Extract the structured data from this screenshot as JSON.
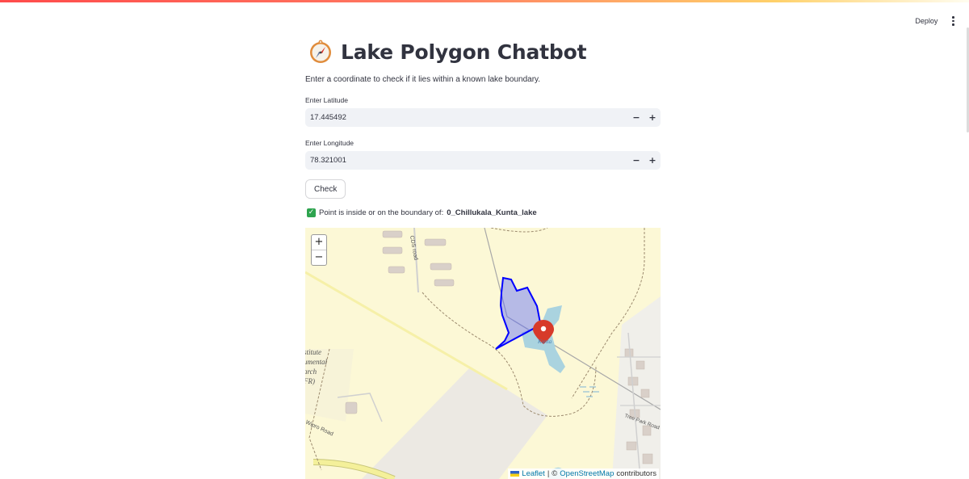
{
  "header": {
    "deploy_label": "Deploy",
    "menu_icon": "kebab-menu-icon"
  },
  "title": {
    "icon": "compass-icon",
    "text": "Lake Polygon Chatbot"
  },
  "caption": "Enter a coordinate to check if it lies within a known lake boundary.",
  "latitude": {
    "label": "Enter Latitude",
    "value": "17.445492",
    "decrement": "−",
    "increment": "+"
  },
  "longitude": {
    "label": "Enter Longitude",
    "value": "78.321001",
    "decrement": "−",
    "increment": "+"
  },
  "check_button": "Check",
  "result": {
    "icon": "check-mark-icon",
    "prefix": "Point is inside or on the boundary of:",
    "lake_name": "0_Chillukala_Kunta_lake"
  },
  "map": {
    "zoom_in": "+",
    "zoom_out": "−",
    "labels": {
      "road_cds": "CDS road",
      "institute_lines": [
        "stitute",
        "umental",
        "arch",
        "FR)"
      ],
      "wipro_road": "Wipro Road",
      "tree_park_road": "Tree Park Road",
      "lake_label": "Kunta"
    },
    "marker_icon": "map-marker-icon",
    "polygon_color": "#0000ff",
    "water_color": "#aad3df",
    "attribution": {
      "leaflet": "Leaflet",
      "separator": "|",
      "copyright": "©",
      "osm": "OpenStreetMap",
      "suffix": "contributors"
    }
  },
  "colors": {
    "accent": "#ff4b4b",
    "input_bg": "#f0f2f6",
    "text": "#31333f",
    "success": "#2ea44f"
  }
}
